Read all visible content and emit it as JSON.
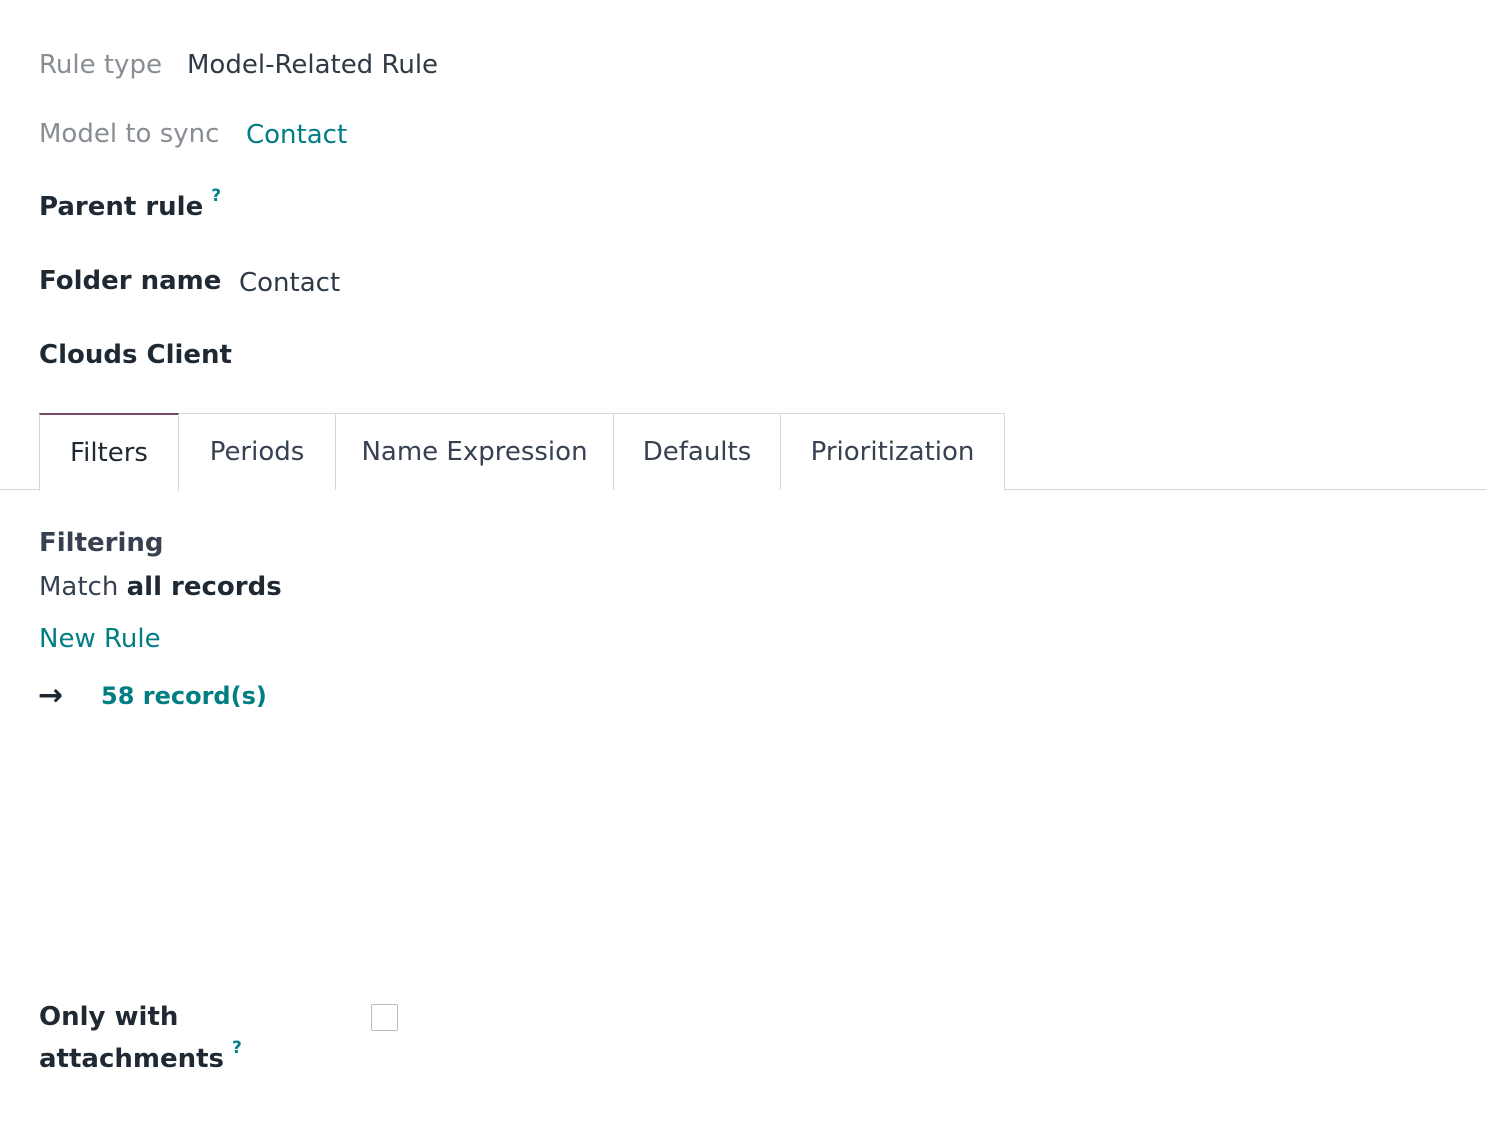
{
  "fields": {
    "rule_type": {
      "label": "Rule type",
      "value": "Model-Related Rule"
    },
    "model_to_sync": {
      "label": "Model to sync",
      "value": "Contact"
    },
    "parent_rule": {
      "label": "Parent rule",
      "help": "?"
    },
    "folder_name": {
      "label": "Folder name",
      "value": "Contact"
    },
    "clouds_client": {
      "label": "Clouds Client"
    }
  },
  "tabs": [
    {
      "label": "Filters",
      "active": true
    },
    {
      "label": "Periods",
      "active": false
    },
    {
      "label": "Name Expression",
      "active": false
    },
    {
      "label": "Defaults",
      "active": false
    },
    {
      "label": "Prioritization",
      "active": false
    }
  ],
  "filters": {
    "title": "Filtering",
    "match_prefix": "Match",
    "match_bold": "all records",
    "new_rule": "New Rule",
    "arrow": "→",
    "records": "58 record(s)"
  },
  "attachments": {
    "label_line1": "Only with",
    "label_line2": "attachments",
    "help": "?",
    "checked": false
  }
}
